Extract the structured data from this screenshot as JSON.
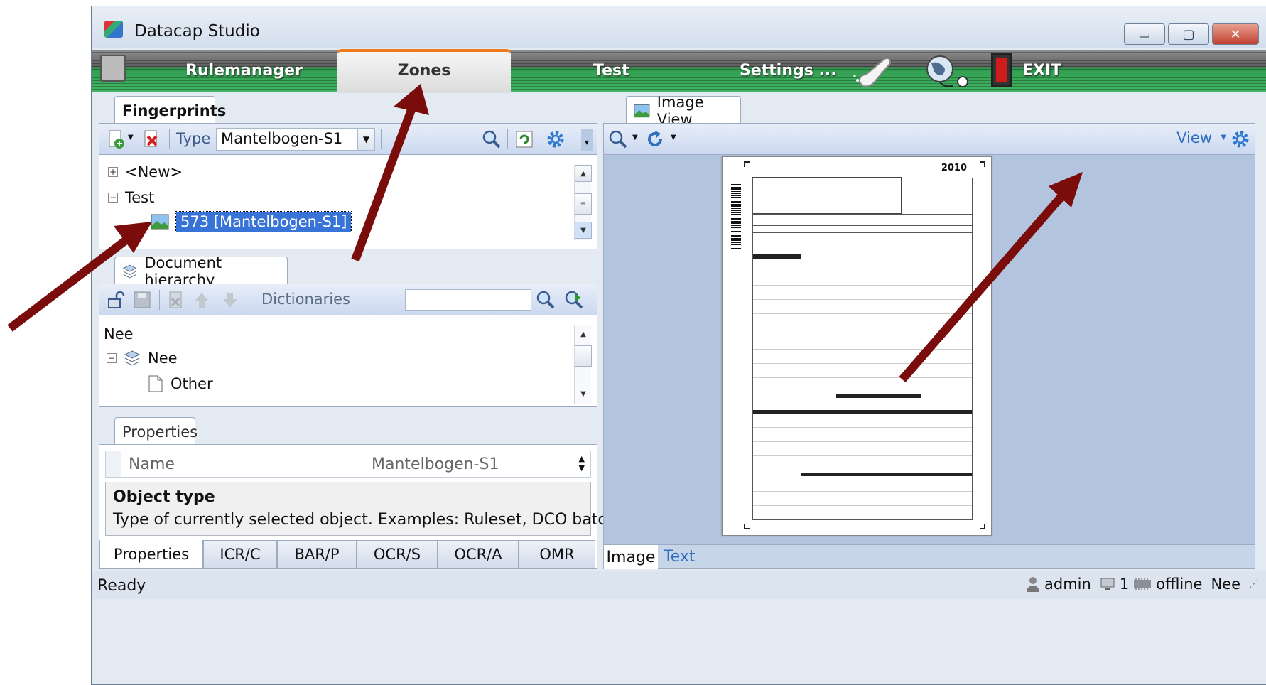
{
  "window": {
    "title": "Datacap Studio",
    "controls": {
      "minimize": "▭",
      "maximize": "▢",
      "close": "✕"
    }
  },
  "menubar": {
    "items": [
      "Rulemanager",
      "Zones",
      "Test",
      "Settings ...",
      "EXIT"
    ],
    "active": "Zones"
  },
  "fingerprints": {
    "tab_label": "Fingerprints",
    "type_label": "Type",
    "type_value": "Mantelbogen-S1",
    "tree": [
      {
        "label": "<New>",
        "expander": "+"
      },
      {
        "label": "Test",
        "expander": "−"
      },
      {
        "label": "573 [Mantelbogen-S1]",
        "selected": true
      }
    ]
  },
  "hierarchy": {
    "tab_label": "Document hierarchy",
    "dictionaries_label": "Dictionaries",
    "search_value": "",
    "tree": [
      {
        "label": "Nee"
      },
      {
        "label": "Nee",
        "expander": "−"
      },
      {
        "label": "Other"
      }
    ]
  },
  "properties": {
    "tab_label": "Properties",
    "name_label": "Name",
    "name_value": "Mantelbogen-S1",
    "description_title": "Object type",
    "description_text": "Type of currently selected object. Examples: Ruleset, DCO batch, DCO ...",
    "bottom_tabs": [
      "Properties",
      "ICR/C",
      "BAR/P",
      "OCR/S",
      "OCR/A",
      "OMR"
    ]
  },
  "image_view": {
    "tab_label": "Image View",
    "view_label": "View",
    "bottom_tabs": [
      "Image",
      "Text"
    ],
    "doc_year": "2010"
  },
  "status": {
    "text": "Ready",
    "user": "admin",
    "count": "1",
    "connection": "offline",
    "extra": "Nee"
  },
  "colors": {
    "annotation_arrow": "#7a0c0c",
    "zones_accent": "#f07a1e",
    "selection": "#3874d8"
  }
}
